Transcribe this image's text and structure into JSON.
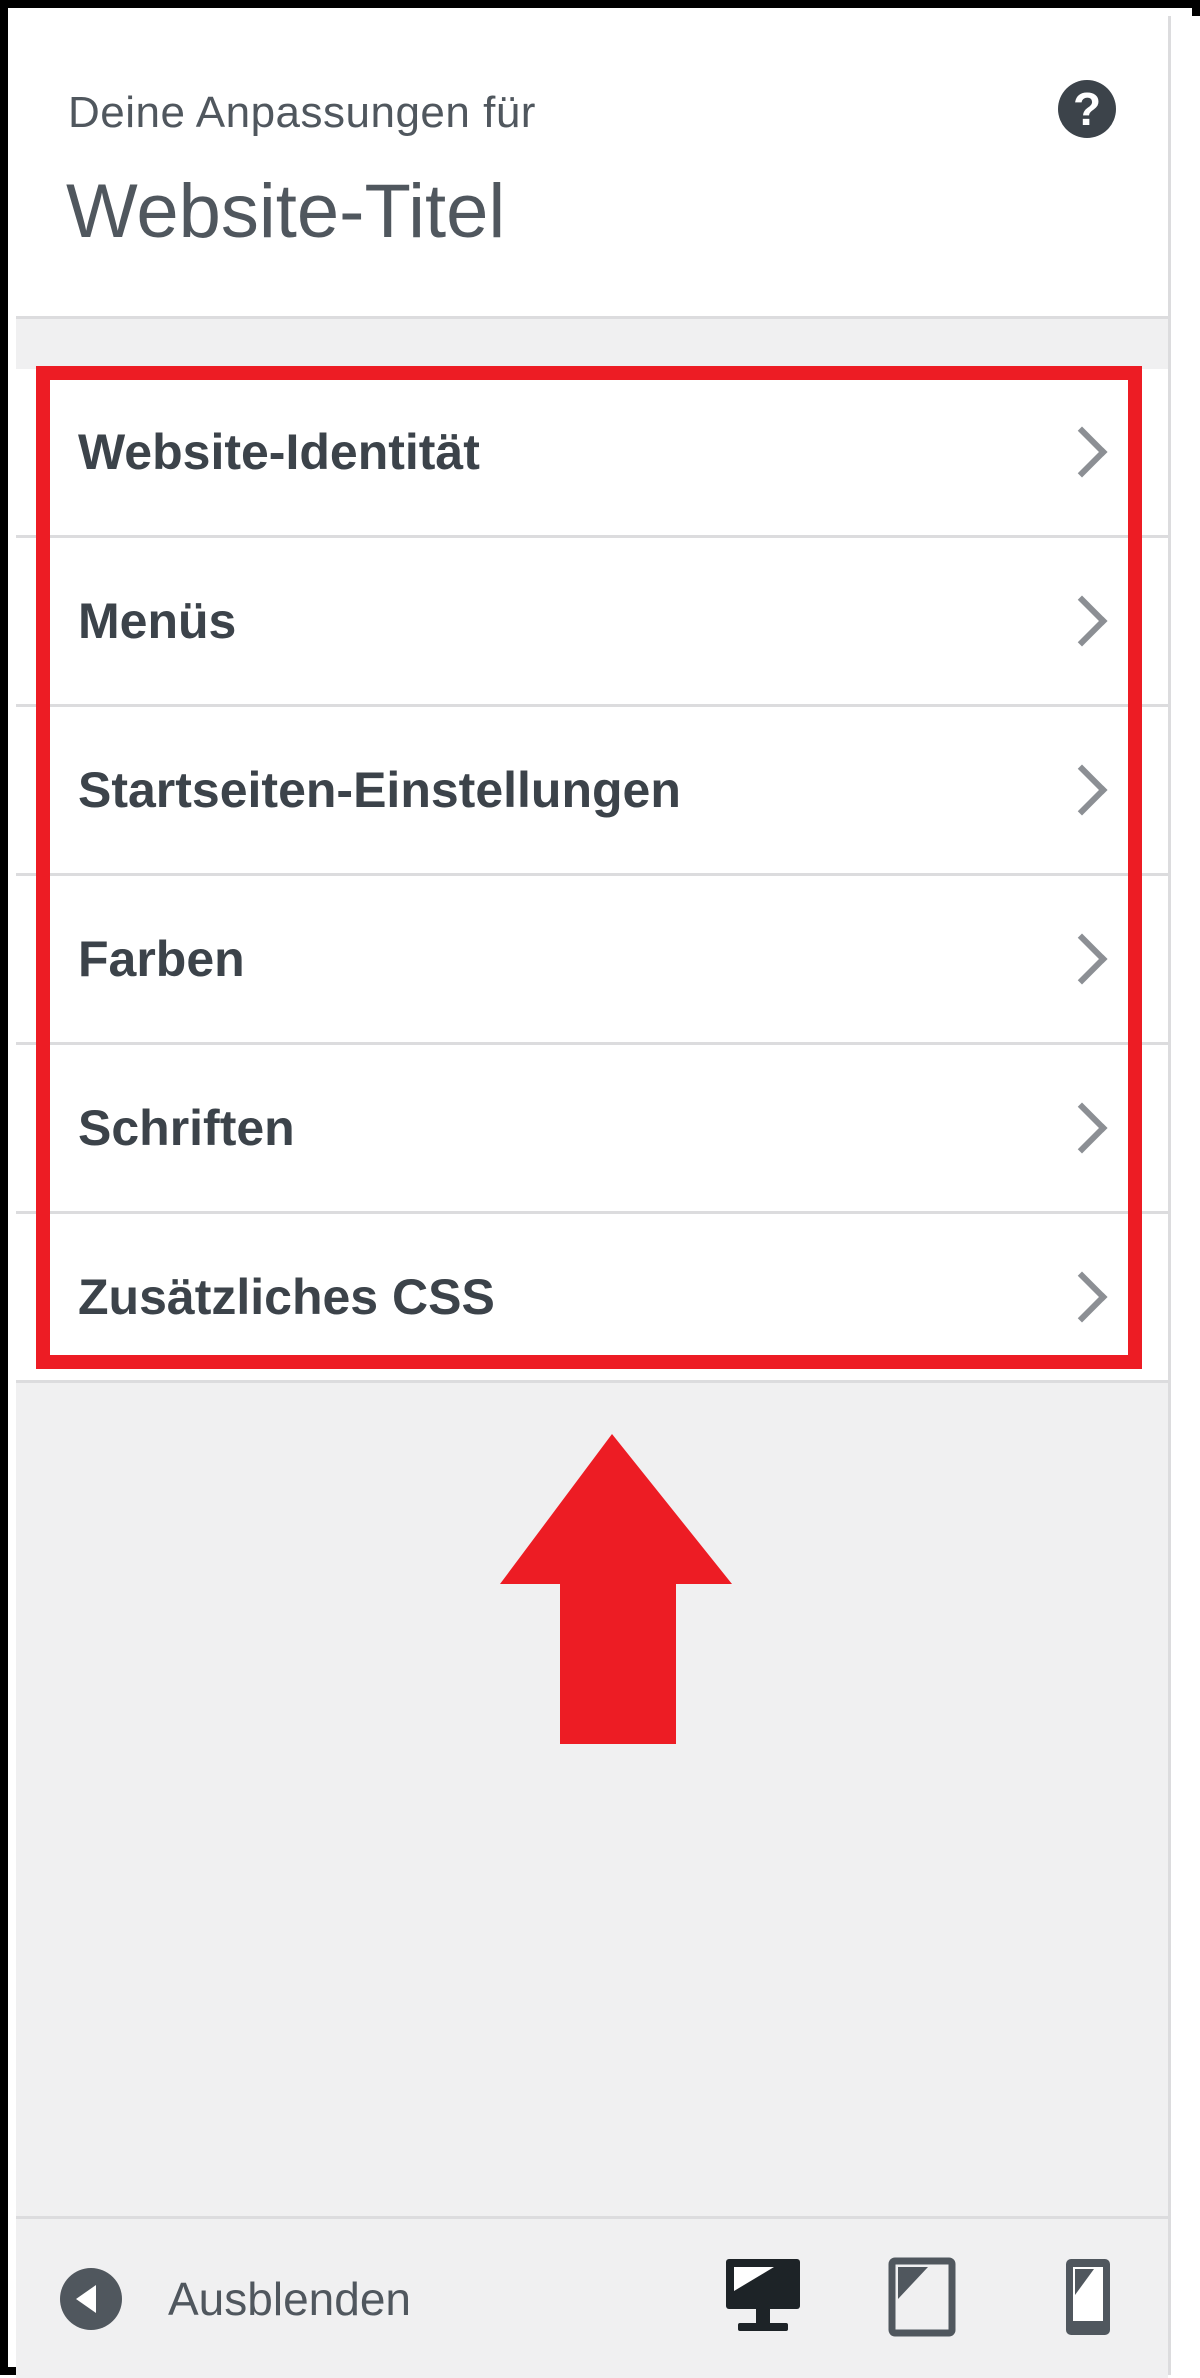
{
  "header": {
    "subtitle": "Deine Anpassungen für",
    "title": "Website-Titel",
    "help_icon": "help-icon"
  },
  "menu": {
    "items": [
      {
        "label": "Website-Identität"
      },
      {
        "label": "Menüs"
      },
      {
        "label": "Startseiten-Einstellungen"
      },
      {
        "label": "Farben"
      },
      {
        "label": "Schriften"
      },
      {
        "label": "Zusätzliches CSS"
      }
    ]
  },
  "footer": {
    "collapse_label": "Ausblenden",
    "devices": [
      "desktop-icon",
      "tablet-icon",
      "mobile-icon"
    ],
    "active_device": "desktop"
  },
  "colors": {
    "highlight": "#ed1c24",
    "panel_bg": "#f0f0f1",
    "text": "#3c434a"
  }
}
